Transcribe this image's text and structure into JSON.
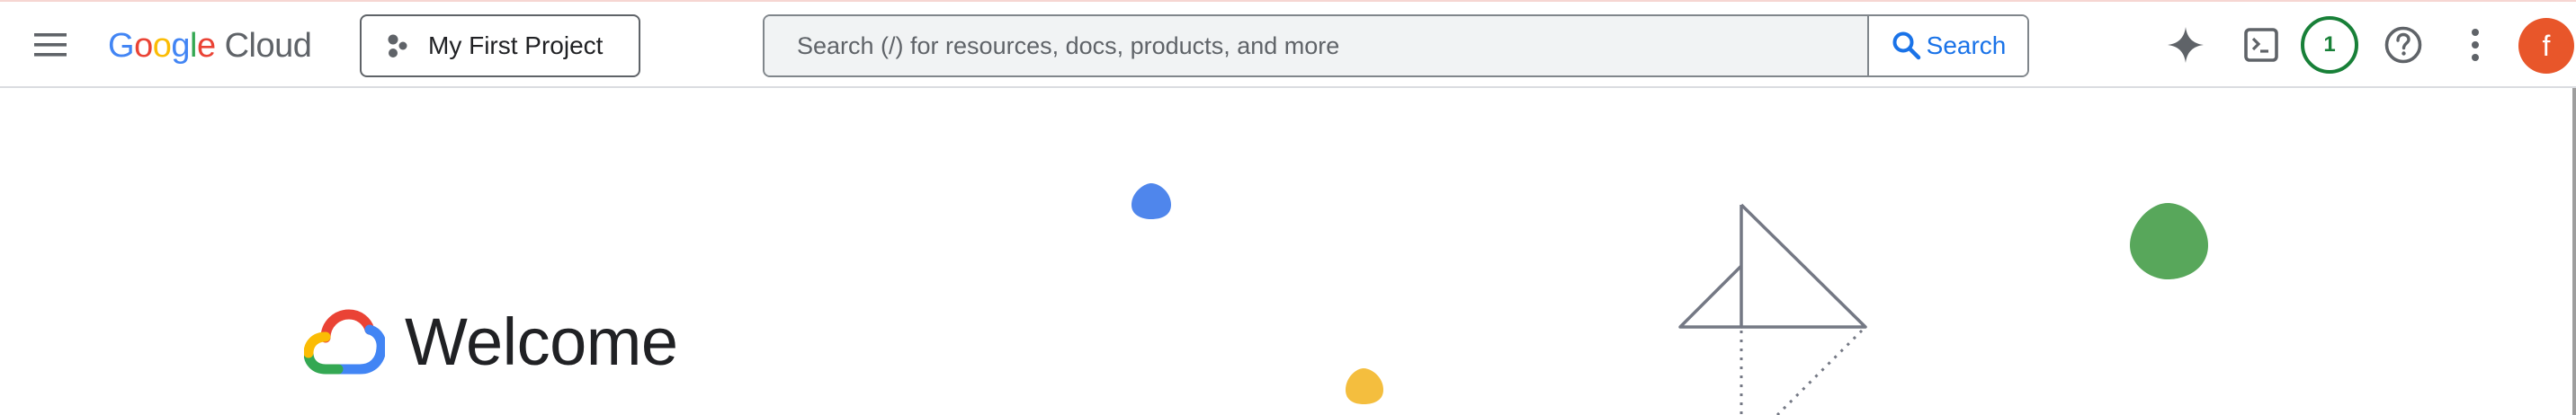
{
  "header": {
    "menu_icon": "hamburger-menu-icon",
    "logo": {
      "google": [
        "G",
        "o",
        "o",
        "g",
        "l",
        "e"
      ],
      "product": "Cloud",
      "colors": [
        "#4285f4",
        "#ea4335",
        "#fbbc04",
        "#4285f4",
        "#34a853",
        "#ea4335"
      ]
    },
    "project": {
      "label": "My First Project",
      "icon": "project-nodes-icon"
    },
    "search": {
      "placeholder": "Search (/) for resources, docs, products, and more",
      "value": "",
      "button_label": "Search"
    },
    "actions": {
      "gemini_icon": "gemini-sparkle-icon",
      "terminal_icon": "cloud-shell-terminal-icon",
      "notification_count": "1",
      "help_icon": "help-icon",
      "more_icon": "more-vert-icon",
      "avatar_letter": "f",
      "avatar_color": "#e8562a"
    }
  },
  "main": {
    "welcome_title": "Welcome",
    "brand_icon": "google-cloud-logo-icon"
  },
  "colors": {
    "accent_blue": "#1a73e8",
    "notification_green": "#188038",
    "deco_blue": "#4f86ec",
    "deco_yellow": "#f4be3e",
    "deco_green": "#58a75b",
    "deco_gray": "#747884"
  }
}
